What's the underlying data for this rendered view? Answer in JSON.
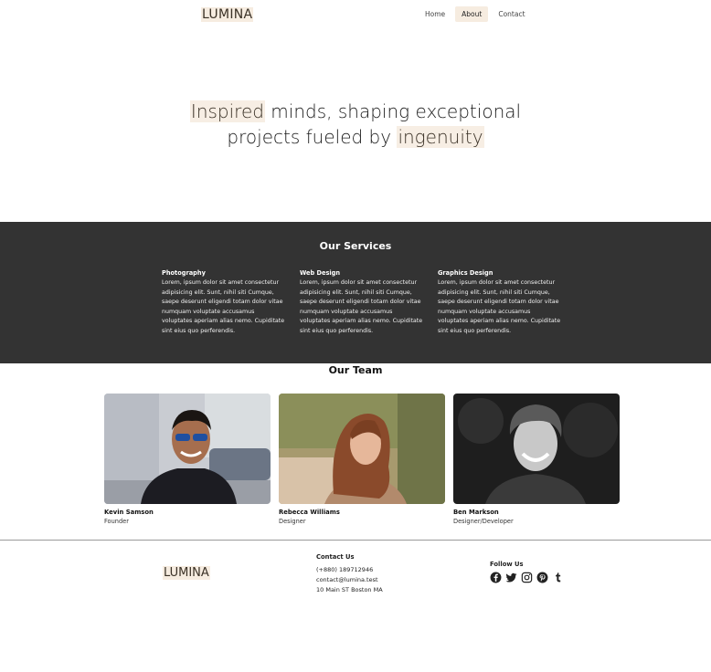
{
  "header": {
    "logo": "LUMINA",
    "nav": [
      {
        "label": "Home",
        "active": false
      },
      {
        "label": "About",
        "active": true
      },
      {
        "label": "Contact",
        "active": false
      }
    ]
  },
  "hero": {
    "word1": "Inspired",
    "text1": " minds, shaping exceptional",
    "text2": "projects fueled by ",
    "word2": "ingenuity"
  },
  "services": {
    "title": "Our Services",
    "items": [
      {
        "title": "Photography",
        "text": "Lorem, ipsum dolor sit amet consectetur adipisicing elit. Sunt, nihil siti Cumque, saepe deserunt eligendi totam dolor vitae numquam voluptate accusamus voluptates aperiam alias nemo. Cupiditate sint eius quo perferendis."
      },
      {
        "title": "Web Design",
        "text": "Lorem, ipsum dolor sit amet consectetur adipisicing elit. Sunt, nihil siti Cumque, saepe deserunt eligendi totam dolor vitae numquam voluptate accusamus voluptates aperiam alias nemo. Cupiditate sint eius quo perferendis."
      },
      {
        "title": "Graphics Design",
        "text": "Lorem, ipsum dolor sit amet consectetur adipisicing elit. Sunt, nihil siti Cumque, saepe deserunt eligendi totam dolor vitae numquam voluptate accusamus voluptates aperiam alias nemo. Cupiditate sint eius quo perferendis."
      }
    ]
  },
  "team": {
    "title": "Our Team",
    "members": [
      {
        "name": "Kevin Samson",
        "role": "Founder"
      },
      {
        "name": "Rebecca Williams",
        "role": "Designer"
      },
      {
        "name": "Ben Markson",
        "role": "Designer/Developer"
      }
    ]
  },
  "footer": {
    "logo": "LUMINA",
    "contact_title": "Contact Us",
    "phone": "(+880) 189712946",
    "email": "contact@lumina.test",
    "address": "10 Main ST Boston MA",
    "follow_title": "Follow Us",
    "socials": [
      "facebook-icon",
      "twitter-icon",
      "instagram-icon",
      "pinterest-icon",
      "tumblr-icon"
    ]
  },
  "colors": {
    "highlight": "#f6ece0",
    "services_bg": "#333333",
    "text": "#222222"
  }
}
